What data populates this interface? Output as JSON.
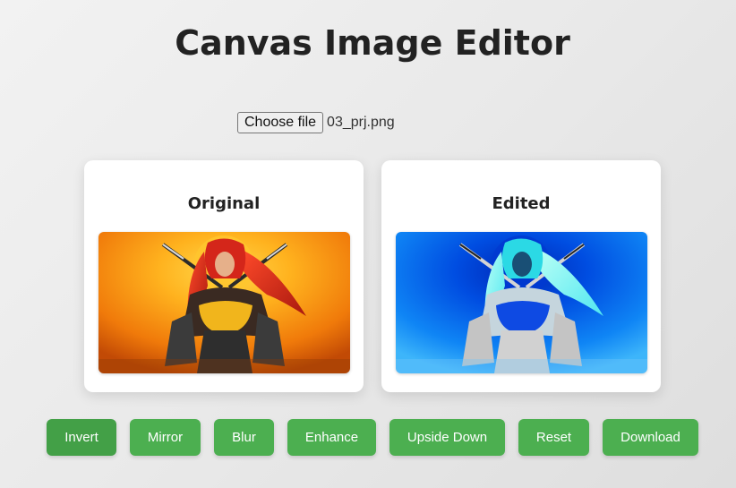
{
  "page": {
    "title": "Canvas Image Editor"
  },
  "file_input": {
    "button_label": "Choose file",
    "file_name": "03_prj.png"
  },
  "panels": {
    "original_label": "Original",
    "edited_label": "Edited"
  },
  "toolbar": {
    "buttons": [
      "Invert",
      "Mirror",
      "Blur",
      "Enhance",
      "Upside Down",
      "Reset",
      "Download"
    ]
  },
  "colors": {
    "button": "#4caf50",
    "button_active": "#43a047"
  }
}
